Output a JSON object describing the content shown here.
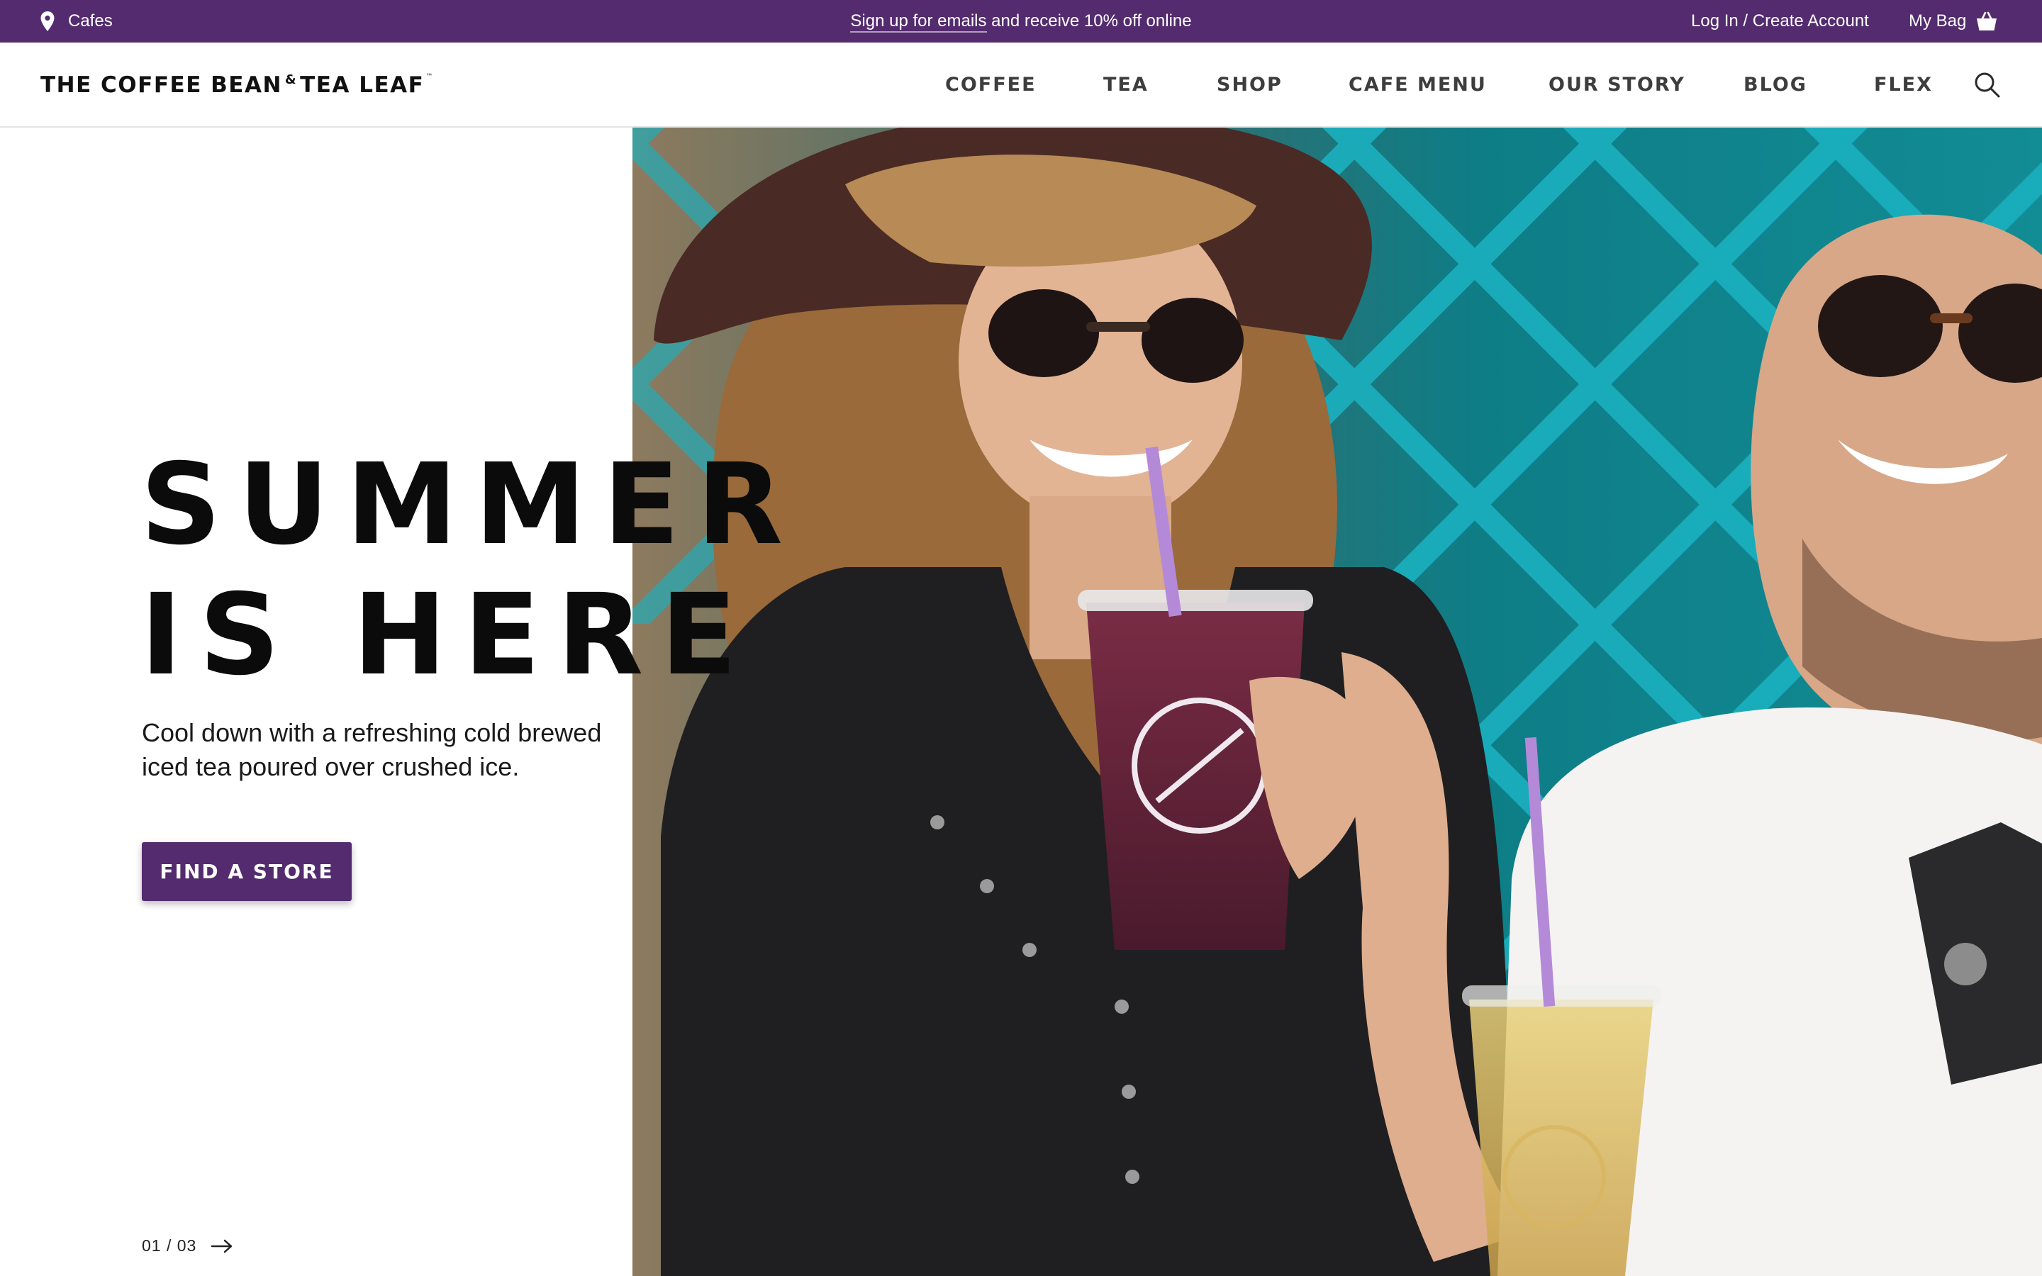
{
  "topbar": {
    "location_label": "Cafes",
    "promo_link": "Sign up for emails",
    "promo_text": " and receive 10% off online",
    "account_link": "Log In / Create Account",
    "bag_label": "My Bag"
  },
  "header": {
    "logo": {
      "part1": "THE COFFEE BEAN",
      "amp": "&",
      "part2": "TEA LEAF",
      "tm": "™"
    },
    "nav": [
      "COFFEE",
      "TEA",
      "SHOP",
      "CAFE MENU",
      "OUR STORY",
      "BLOG",
      "FLEX"
    ]
  },
  "hero": {
    "headline_line1": "SUMMER",
    "headline_line2": "IS HERE",
    "subtext": "Cool down with a refreshing cold brewed iced tea poured over crushed ice.",
    "cta_label": "FIND A STORE",
    "pager": "01 / 03"
  },
  "colors": {
    "brand_purple": "#532b6e",
    "header_bg": "#ffffff",
    "nav_text": "#3d3d3d",
    "headline": "#0b0b0b",
    "lattice_teal": "#17a5b3"
  },
  "icons": {
    "location": "map-pin-icon",
    "bag": "shopping-bag-icon",
    "search": "search-icon",
    "next": "arrow-right-icon"
  }
}
